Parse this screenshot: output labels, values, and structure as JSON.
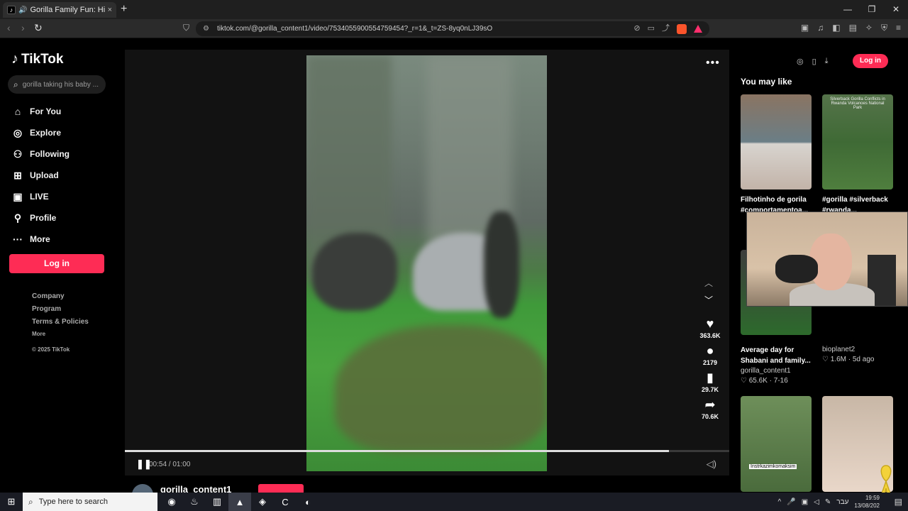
{
  "browser": {
    "tab_title": "Gorilla Family Fun: Hilarious M",
    "url": "tiktok.com/@gorilla_content1/video/7534055900554759454?_r=1&_t=ZS-8yq0nLJ39sO"
  },
  "sidebar": {
    "logo": "TikTok",
    "search_placeholder": "gorilla taking his baby ...",
    "nav": [
      {
        "label": "For You",
        "icon": "home-icon"
      },
      {
        "label": "Explore",
        "icon": "compass-icon"
      },
      {
        "label": "Following",
        "icon": "following-icon"
      },
      {
        "label": "Upload",
        "icon": "upload-icon"
      },
      {
        "label": "LIVE",
        "icon": "live-icon"
      },
      {
        "label": "Profile",
        "icon": "profile-icon"
      },
      {
        "label": "More",
        "icon": "more-icon"
      }
    ],
    "login": "Log in",
    "footer": {
      "company": "Company",
      "program": "Program",
      "terms": "Terms & Policies",
      "more": "More",
      "copyright": "© 2025 TikTok"
    }
  },
  "video": {
    "likes": "363.6K",
    "comments": "2179",
    "saves": "29.7K",
    "shares": "70.6K",
    "time": "00:54 / 01:00",
    "progress_fraction": 0.9,
    "author": "gorilla_content1"
  },
  "right": {
    "login": "Log in",
    "heading": "You may like",
    "items": [
      {
        "title": "Filhotinho de gorila #comportamentoa..."
      },
      {
        "title": "#gorilla #silverback #rwanda...",
        "caption": "Silverback Gorilla Conflicts in Rwanda Volcanoes National Park"
      },
      {
        "title": "Average day for Shabani and family...",
        "author": "gorilla_content1",
        "likes": "65.6K",
        "date": "7-16"
      },
      {
        "author": "bioplanet2",
        "likes": "1.6M",
        "date": "5d ago"
      },
      {
        "caption": "Instrkazimkomaksim"
      }
    ]
  },
  "taskbar": {
    "search_placeholder": "Type here to search",
    "lang": "עבר",
    "time": "19:59",
    "date": "13/08/202"
  },
  "colors": {
    "accent": "#fe2c55"
  }
}
